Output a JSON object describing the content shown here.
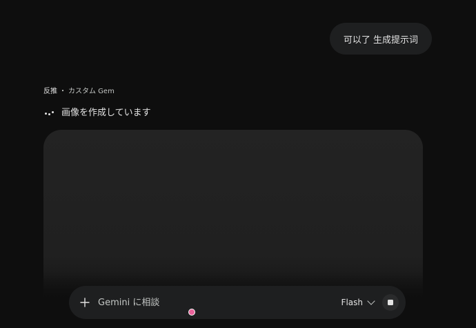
{
  "conversation": {
    "user_message": "可以了 生成提示词",
    "response": {
      "gem_name": "反推",
      "separator": "・",
      "gem_type": "カスタム Gem",
      "status_text": "画像を作成しています"
    }
  },
  "composer": {
    "placeholder": "Gemini に相談",
    "add_icon": "plus-icon",
    "model_label": "Flash",
    "model_icon": "chevron-down-icon",
    "stop_icon": "stop-icon"
  },
  "colors": {
    "background": "#0e0e0e",
    "surface": "#1e1f20",
    "text": "#e3e3e3",
    "cursor": "#e9639a"
  }
}
